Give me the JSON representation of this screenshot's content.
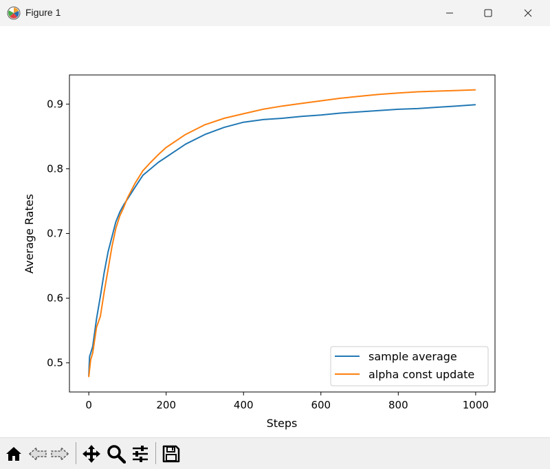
{
  "window": {
    "title": "Figure 1"
  },
  "toolbar": {
    "icons": [
      "home-icon",
      "back-icon",
      "forward-icon",
      "pan-icon",
      "zoom-icon",
      "configure-subplots-icon",
      "save-icon"
    ]
  },
  "colors": {
    "series1": "#1f77b4",
    "series2": "#ff7f0e"
  },
  "chart_data": {
    "type": "line",
    "title": "",
    "xlabel": "Steps",
    "ylabel": "Average Rates",
    "xlim": [
      -50,
      1050
    ],
    "ylim": [
      0.455,
      0.945
    ],
    "xticks": [
      0,
      200,
      400,
      600,
      800,
      1000
    ],
    "xtick_labels": [
      "0",
      "200",
      "400",
      "600",
      "800",
      "1000"
    ],
    "yticks": [
      0.5,
      0.6,
      0.7,
      0.8,
      0.9
    ],
    "ytick_labels": [
      "0.5",
      "0.6",
      "0.7",
      "0.8",
      "0.9"
    ],
    "grid": false,
    "legend_position": "lower-right",
    "series": [
      {
        "name": "sample average",
        "color": "#1f77b4",
        "x": [
          0,
          2,
          5,
          10,
          20,
          30,
          40,
          50,
          60,
          70,
          80,
          90,
          100,
          120,
          140,
          160,
          180,
          200,
          250,
          300,
          350,
          400,
          450,
          500,
          550,
          600,
          650,
          700,
          750,
          800,
          850,
          900,
          950,
          1000
        ],
        "y": [
          0.48,
          0.51,
          0.515,
          0.525,
          0.568,
          0.603,
          0.64,
          0.672,
          0.695,
          0.718,
          0.733,
          0.744,
          0.753,
          0.772,
          0.79,
          0.8,
          0.81,
          0.818,
          0.838,
          0.853,
          0.864,
          0.872,
          0.876,
          0.878,
          0.881,
          0.883,
          0.886,
          0.888,
          0.89,
          0.892,
          0.893,
          0.895,
          0.897,
          0.899
        ]
      },
      {
        "name": "alpha const update",
        "color": "#ff7f0e",
        "x": [
          0,
          2,
          5,
          10,
          20,
          30,
          40,
          50,
          60,
          70,
          80,
          90,
          100,
          120,
          140,
          160,
          180,
          200,
          250,
          300,
          350,
          400,
          450,
          500,
          550,
          600,
          650,
          700,
          750,
          800,
          850,
          900,
          950,
          1000
        ],
        "y": [
          0.478,
          0.49,
          0.505,
          0.515,
          0.555,
          0.572,
          0.61,
          0.645,
          0.68,
          0.708,
          0.727,
          0.74,
          0.755,
          0.778,
          0.797,
          0.81,
          0.822,
          0.833,
          0.853,
          0.868,
          0.878,
          0.885,
          0.892,
          0.897,
          0.901,
          0.905,
          0.909,
          0.912,
          0.915,
          0.917,
          0.919,
          0.92,
          0.921,
          0.922
        ]
      }
    ]
  }
}
